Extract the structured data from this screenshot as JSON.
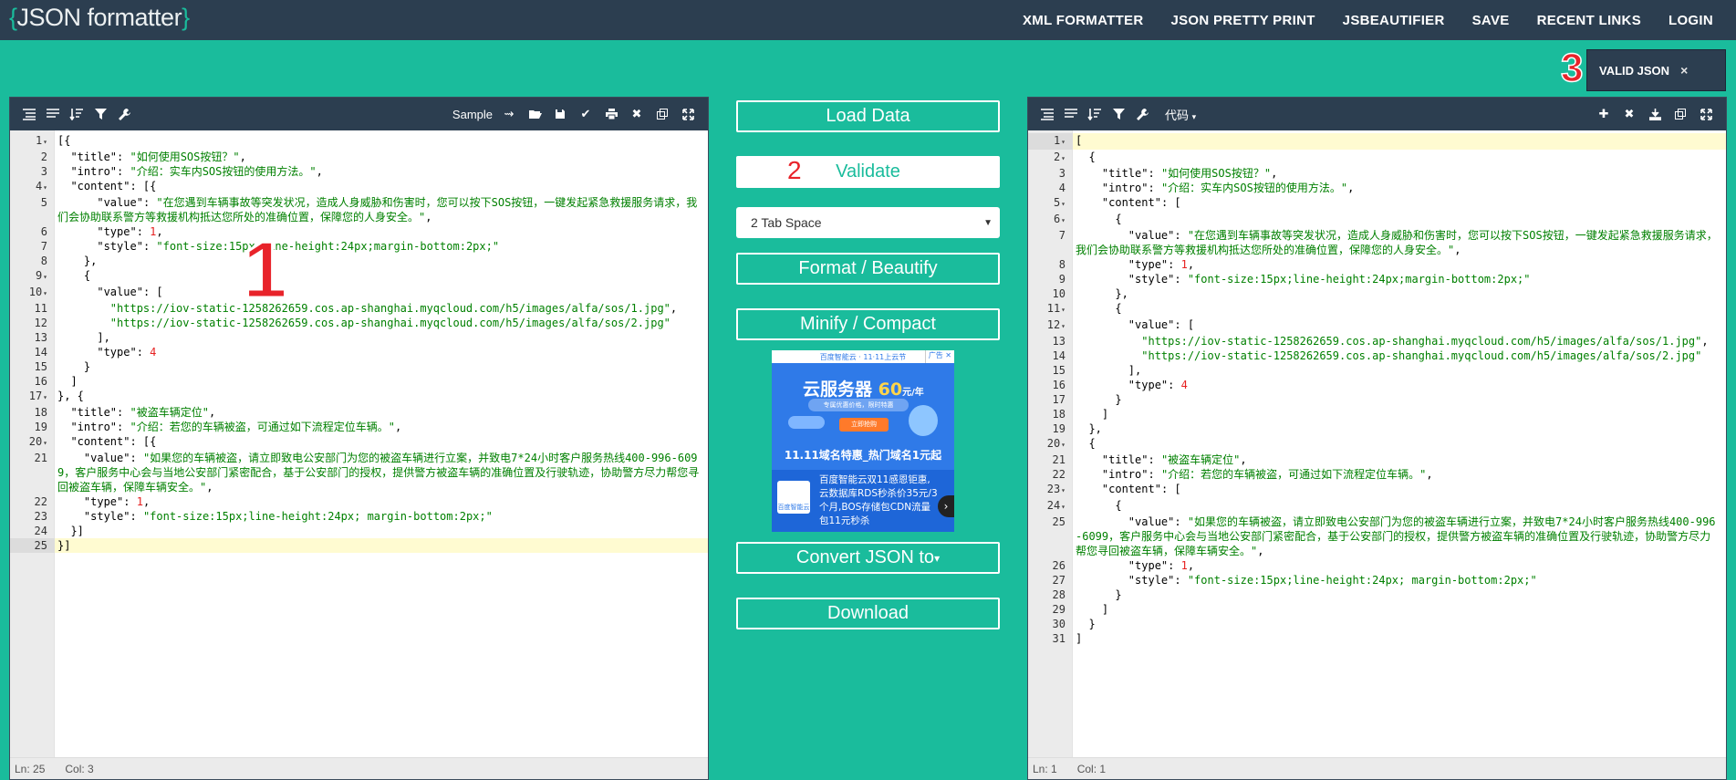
{
  "header": {
    "logo_open": "{",
    "logo_text": "JSON formatter",
    "logo_close": "}",
    "nav": [
      "XML FORMATTER",
      "JSON PRETTY PRINT",
      "JSBEAUTIFIER",
      "SAVE",
      "RECENT LINKS",
      "LOGIN"
    ]
  },
  "annotations": {
    "badge1": "1",
    "badge2": "2",
    "badge3": "3"
  },
  "validity": {
    "label": "VALID JSON",
    "close": "×"
  },
  "left_editor": {
    "sample_label": "Sample",
    "status_ln": "Ln: 25",
    "status_col": "Col: 3"
  },
  "right_editor": {
    "mode_label": "代码",
    "status_ln": "Ln: 1",
    "status_col": "Col: 1"
  },
  "middle": {
    "load_data": "Load Data",
    "validate": "Validate",
    "tab_space": "2 Tab Space",
    "format": "Format / Beautify",
    "minify": "Minify / Compact",
    "convert": "Convert JSON to",
    "download": "Download"
  },
  "ad": {
    "top": "百度智能云 · 11·11上云节",
    "tag": "广告 ✕",
    "headline_a": "云服务器 ",
    "headline_b": "60",
    "headline_c": "元/年",
    "pill": "专属优惠价格，限时特惠",
    "button": "立即抢购",
    "banner": "11.11域名特惠_热门域名1元起",
    "logo": "百度智能云",
    "body": "百度智能云双11感恩钜惠,云数据库RDS秒杀价35元/3个月,BOS存储包CDN流量包11元秒杀"
  },
  "left_code": [
    {
      "n": "1",
      "f": true,
      "t": "[{"
    },
    {
      "n": "2",
      "t": "  \"title\": \"如何使用SOS按钮？\","
    },
    {
      "n": "3",
      "t": "  \"intro\": \"介绍：实车内SOS按钮的使用方法。\","
    },
    {
      "n": "4",
      "f": true,
      "t": "  \"content\": [{"
    },
    {
      "n": "5",
      "t": "      \"value\": \"在您遇到车辆事故等突发状况，造成人身威胁和伤害时，您可以按下SOS按钮，一键发起紧急救援服务请求，我们会协助联系警方等救援机构抵达您所处的准确位置，保障您的人身安全。\","
    },
    {
      "n": "6",
      "t": "      \"type\": 1,"
    },
    {
      "n": "7",
      "t": "      \"style\": \"font-size:15px;line-height:24px;margin-bottom:2px;\""
    },
    {
      "n": "8",
      "t": "    },"
    },
    {
      "n": "9",
      "f": true,
      "t": "    {"
    },
    {
      "n": "10",
      "f": true,
      "t": "      \"value\": ["
    },
    {
      "n": "11",
      "t": "        \"https://iov-static-1258262659.cos.ap-shanghai.myqcloud.com/h5/images/alfa/sos/1.jpg\","
    },
    {
      "n": "12",
      "t": "        \"https://iov-static-1258262659.cos.ap-shanghai.myqcloud.com/h5/images/alfa/sos/2.jpg\""
    },
    {
      "n": "13",
      "t": "      ],"
    },
    {
      "n": "14",
      "t": "      \"type\": 4"
    },
    {
      "n": "15",
      "t": "    }"
    },
    {
      "n": "16",
      "t": "  ]"
    },
    {
      "n": "17",
      "f": true,
      "t": "}, {"
    },
    {
      "n": "18",
      "t": "  \"title\": \"被盗车辆定位\","
    },
    {
      "n": "19",
      "t": "  \"intro\": \"介绍：若您的车辆被盗，可通过如下流程定位车辆。\","
    },
    {
      "n": "20",
      "f": true,
      "t": "  \"content\": [{"
    },
    {
      "n": "21",
      "t": "    \"value\": \"如果您的车辆被盗，请立即致电公安部门为您的被盗车辆进行立案，并致电7*24小时客户服务热线400-996-6099，客户服务中心会与当地公安部门紧密配合，基于公安部门的授权，提供警方被盗车辆的准确位置及行驶轨迹，协助警方尽力帮您寻回被盗车辆，保障车辆安全。\","
    },
    {
      "n": "22",
      "t": "    \"type\": 1,"
    },
    {
      "n": "23",
      "t": "    \"style\": \"font-size:15px;line-height:24px; margin-bottom:2px;\""
    },
    {
      "n": "24",
      "t": "  }]"
    },
    {
      "n": "25",
      "t": "}]",
      "active": true
    }
  ],
  "right_code": [
    {
      "n": "1",
      "f": true,
      "t": "[",
      "active": true
    },
    {
      "n": "2",
      "f": true,
      "t": "  {"
    },
    {
      "n": "3",
      "t": "    \"title\": \"如何使用SOS按钮？\","
    },
    {
      "n": "4",
      "t": "    \"intro\": \"介绍：实车内SOS按钮的使用方法。\","
    },
    {
      "n": "5",
      "f": true,
      "t": "    \"content\": ["
    },
    {
      "n": "6",
      "f": true,
      "t": "      {"
    },
    {
      "n": "7",
      "t": "        \"value\": \"在您遇到车辆事故等突发状况，造成人身威胁和伤害时，您可以按下SOS按钮，一键发起紧急救援服务请求，我们会协助联系警方等救援机构抵达您所处的准确位置，保障您的人身安全。\","
    },
    {
      "n": "8",
      "t": "        \"type\": 1,"
    },
    {
      "n": "9",
      "t": "        \"style\": \"font-size:15px;line-height:24px;margin-bottom:2px;\""
    },
    {
      "n": "10",
      "t": "      },"
    },
    {
      "n": "11",
      "f": true,
      "t": "      {"
    },
    {
      "n": "12",
      "f": true,
      "t": "        \"value\": ["
    },
    {
      "n": "13",
      "t": "          \"https://iov-static-1258262659.cos.ap-shanghai.myqcloud.com/h5/images/alfa/sos/1.jpg\","
    },
    {
      "n": "14",
      "t": "          \"https://iov-static-1258262659.cos.ap-shanghai.myqcloud.com/h5/images/alfa/sos/2.jpg\""
    },
    {
      "n": "15",
      "t": "        ],"
    },
    {
      "n": "16",
      "t": "        \"type\": 4"
    },
    {
      "n": "17",
      "t": "      }"
    },
    {
      "n": "18",
      "t": "    ]"
    },
    {
      "n": "19",
      "t": "  },"
    },
    {
      "n": "20",
      "f": true,
      "t": "  {"
    },
    {
      "n": "21",
      "t": "    \"title\": \"被盗车辆定位\","
    },
    {
      "n": "22",
      "t": "    \"intro\": \"介绍：若您的车辆被盗，可通过如下流程定位车辆。\","
    },
    {
      "n": "23",
      "f": true,
      "t": "    \"content\": ["
    },
    {
      "n": "24",
      "f": true,
      "t": "      {"
    },
    {
      "n": "25",
      "t": "        \"value\": \"如果您的车辆被盗，请立即致电公安部门为您的被盗车辆进行立案，并致电7*24小时客户服务热线400-996-6099，客户服务中心会与当地公安部门紧密配合，基于公安部门的授权，提供警方被盗车辆的准确位置及行驶轨迹，协助警方尽力帮您寻回被盗车辆，保障车辆安全。\","
    },
    {
      "n": "26",
      "t": "        \"type\": 1,"
    },
    {
      "n": "27",
      "t": "        \"style\": \"font-size:15px;line-height:24px; margin-bottom:2px;\""
    },
    {
      "n": "28",
      "t": "      }"
    },
    {
      "n": "29",
      "t": "    ]"
    },
    {
      "n": "30",
      "t": "  }"
    },
    {
      "n": "31",
      "t": "]"
    }
  ]
}
